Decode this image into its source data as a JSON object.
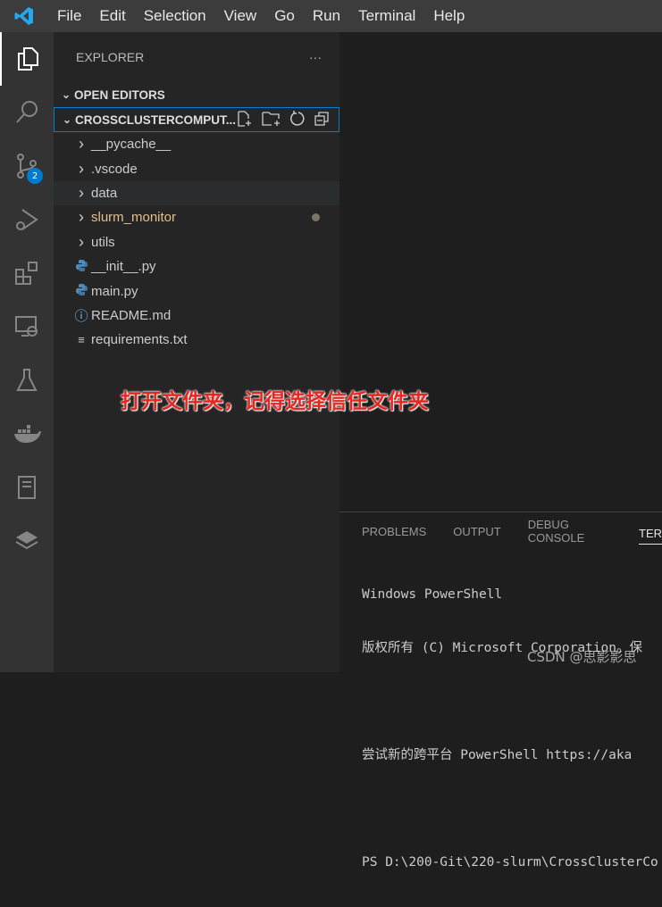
{
  "menubar": {
    "items": [
      "File",
      "Edit",
      "Selection",
      "View",
      "Go",
      "Run",
      "Terminal",
      "Help"
    ]
  },
  "activity": {
    "scm_badge": "2",
    "icons": [
      "files-icon",
      "search-icon",
      "source-control-icon",
      "run-debug-icon",
      "extensions-icon",
      "remote-explorer-icon",
      "testing-icon",
      "docker-icon",
      "notebook-icon",
      "layers-icon"
    ]
  },
  "explorer": {
    "title": "EXPLORER",
    "more": "···",
    "open_editors": "OPEN EDITORS",
    "folder": "CROSSCLUSTERCOMPUT...",
    "items": [
      {
        "label": "__pycache__",
        "type": "folder"
      },
      {
        "label": ".vscode",
        "type": "folder"
      },
      {
        "label": "data",
        "type": "folder"
      },
      {
        "label": "slurm_monitor",
        "type": "folder",
        "modified": true
      },
      {
        "label": "utils",
        "type": "folder"
      },
      {
        "label": "__init__.py",
        "type": "python"
      },
      {
        "label": "main.py",
        "type": "python"
      },
      {
        "label": "README.md",
        "type": "info"
      },
      {
        "label": "requirements.txt",
        "type": "text"
      }
    ]
  },
  "annotation": "打开文件夹，记得选择信任文件夹",
  "panel": {
    "tabs": [
      "PROBLEMS",
      "OUTPUT",
      "DEBUG CONSOLE",
      "TER"
    ],
    "terminal": [
      "Windows PowerShell",
      "版权所有 (C) Microsoft Corporation。保",
      "",
      "尝试新的跨平台 PowerShell https://aka",
      "",
      "PS D:\\200-Git\\220-slurm\\CrossClusterCo"
    ]
  },
  "watermark": "CSDN @思影影思",
  "colors": {
    "accent": "#007acc",
    "annotation": "#e8261f"
  }
}
